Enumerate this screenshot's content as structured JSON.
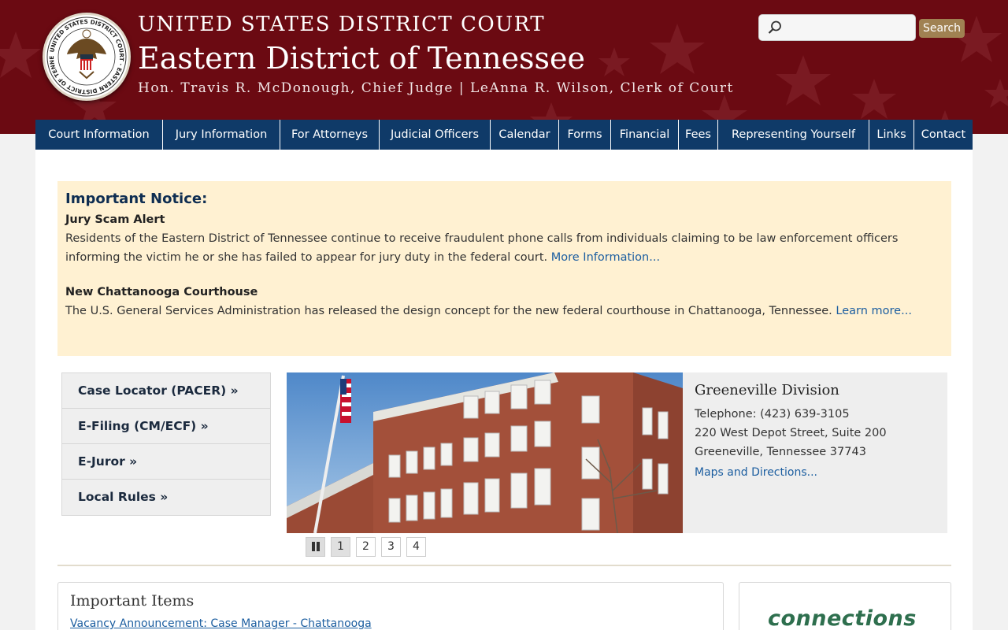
{
  "header": {
    "line1": "UNITED STATES DISTRICT COURT",
    "line2": "Eastern District of Tennessee",
    "line3": "Hon. Travis R. McDonough, Chief Judge | LeAnna R. Wilson, Clerk of Court",
    "seal_text": "UNITED STATES DISTRICT COURT · EASTERN DISTRICT OF TENNESSEE",
    "colors": {
      "banner": "#6b0a12",
      "nav": "#0f3a68",
      "search_button": "#a08152"
    }
  },
  "search": {
    "placeholder": "",
    "icon": "search-icon",
    "button_label": "Search"
  },
  "nav": {
    "items": [
      {
        "label": "Court Information"
      },
      {
        "label": "Jury Information"
      },
      {
        "label": "For Attorneys"
      },
      {
        "label": "Judicial Officers"
      },
      {
        "label": "Calendar"
      },
      {
        "label": "Forms"
      },
      {
        "label": "Financial"
      },
      {
        "label": "Fees"
      },
      {
        "label": "Representing Yourself"
      },
      {
        "label": "Links"
      },
      {
        "label": "Contact"
      }
    ]
  },
  "notice": {
    "heading": "Important Notice:",
    "items": [
      {
        "title": "Jury Scam Alert",
        "text": "Residents of the Eastern District of Tennessee continue to receive fraudulent phone calls from individuals claiming to be law enforcement officers informing the victim he or she has failed to appear for jury duty in the federal court.",
        "link": "More Information..."
      },
      {
        "title": "New Chattanooga Courthouse",
        "text": "The U.S. General Services Administration has released the design concept for the new federal courthouse in Chattanooga, Tennessee.",
        "link": "Learn more..."
      }
    ]
  },
  "quick_links": [
    {
      "label": "Case Locator (PACER) »"
    },
    {
      "label": "E-Filing (CM/ECF) »"
    },
    {
      "label": "E-Juror »"
    },
    {
      "label": "Local Rules »"
    }
  ],
  "slideshow": {
    "division": "Greeneville Division",
    "telephone": "Telephone:  (423) 639-3105",
    "address1": "220 West Depot Street, Suite 200",
    "address2": "Greeneville, Tennessee  37743",
    "maps_link": "Maps and Directions...",
    "pages": [
      "1",
      "2",
      "3",
      "4"
    ],
    "active_page": "1",
    "pause_icon": "pause-icon"
  },
  "important_items": {
    "title": "Important Items",
    "first_item": "Vacancy Announcement: Case Manager - Chattanooga"
  },
  "connections": {
    "logo_text": "connections"
  }
}
